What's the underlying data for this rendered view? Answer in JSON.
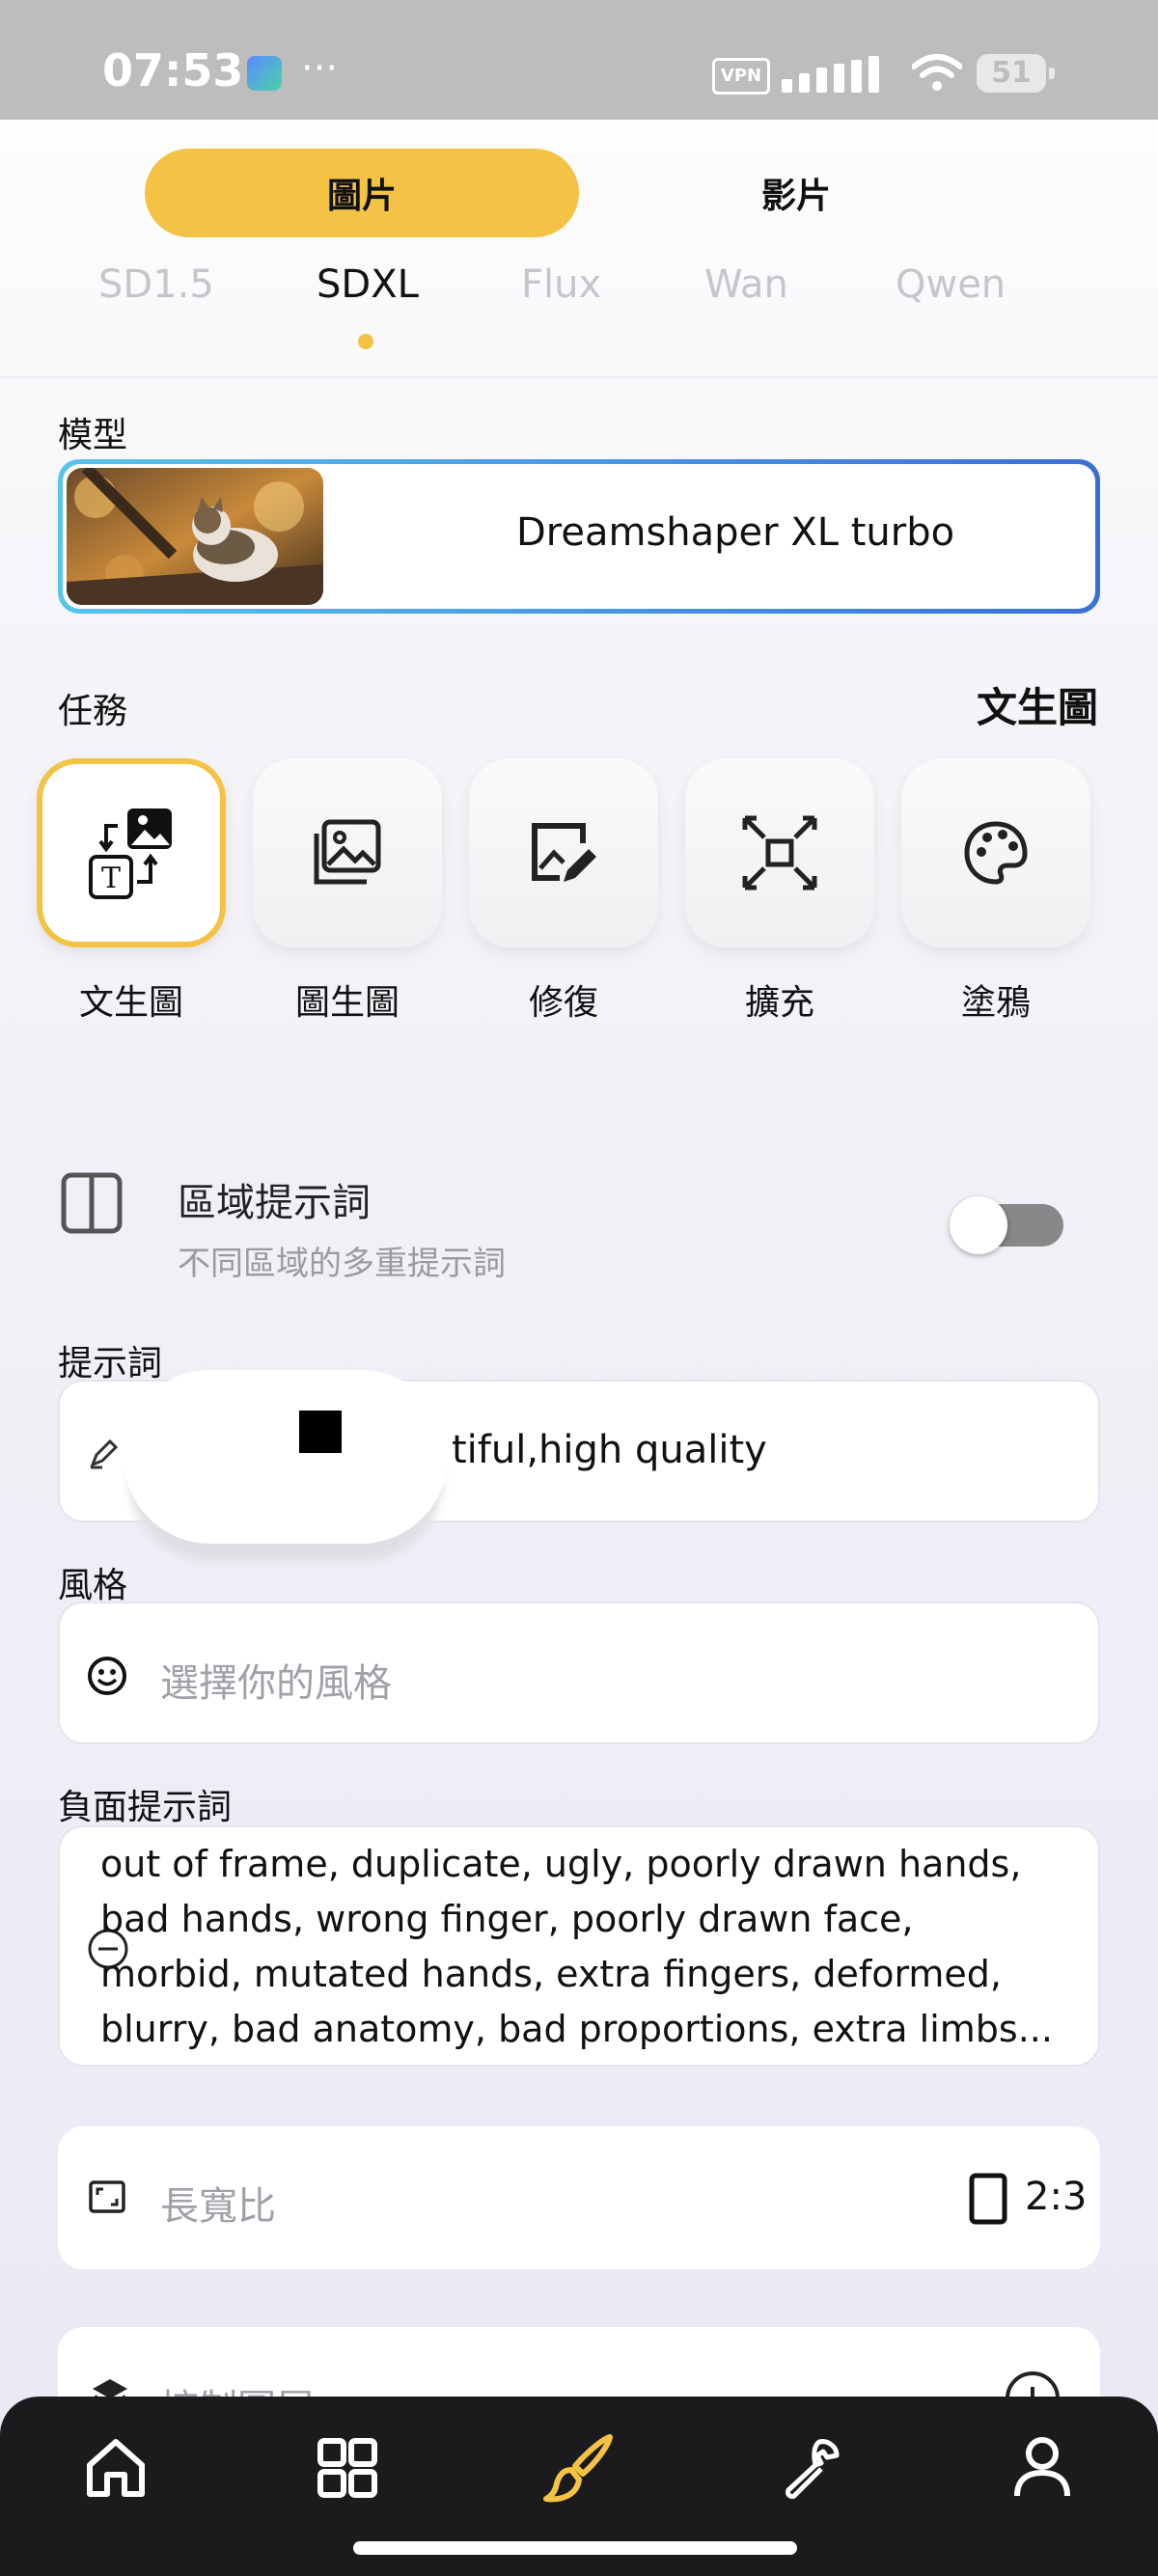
{
  "status_bar": {
    "time": "07:53",
    "dots": "···",
    "vpn": "VPN",
    "battery": "51"
  },
  "media_tabs": {
    "image": "圖片",
    "video": "影片"
  },
  "model_family_tabs": [
    {
      "label": "SD1.5",
      "active": false
    },
    {
      "label": "SDXL",
      "active": true
    },
    {
      "label": "Flux",
      "active": false
    },
    {
      "label": "Wan",
      "active": false
    },
    {
      "label": "Qwen",
      "active": false
    }
  ],
  "model": {
    "label": "模型",
    "name": "Dreamshaper XL turbo"
  },
  "tasks": {
    "label": "任務",
    "current": "文生圖",
    "items": [
      {
        "label": "文生圖",
        "icon": "text-to-image-icon",
        "selected": true
      },
      {
        "label": "圖生圖",
        "icon": "image-to-image-icon",
        "selected": false
      },
      {
        "label": "修復",
        "icon": "inpaint-icon",
        "selected": false
      },
      {
        "label": "擴充",
        "icon": "expand-icon",
        "selected": false
      },
      {
        "label": "塗鴉",
        "icon": "palette-icon",
        "selected": false
      }
    ]
  },
  "regional_prompt": {
    "title": "區域提示詞",
    "subtitle": "不同區域的多重提示詞",
    "enabled": false
  },
  "prompt": {
    "label": "提示詞",
    "value": "tiful,high quality"
  },
  "style": {
    "label": "風格",
    "placeholder": "選擇你的風格"
  },
  "negative_prompt": {
    "label": "負面提示詞",
    "value": " out of frame, duplicate, ugly, poorly drawn hands,\nbad hands, wrong finger, poorly drawn face,\nmorbid, mutated hands, extra fingers, deformed,\nblurry, bad anatomy, bad proportions, extra limbs..."
  },
  "aspect_ratio": {
    "label": "長寬比",
    "value": "2:3"
  },
  "control_layer": {
    "label": "控制圖層"
  },
  "colors": {
    "accent": "#f4c244",
    "nav_bg": "#1b1b1d"
  }
}
